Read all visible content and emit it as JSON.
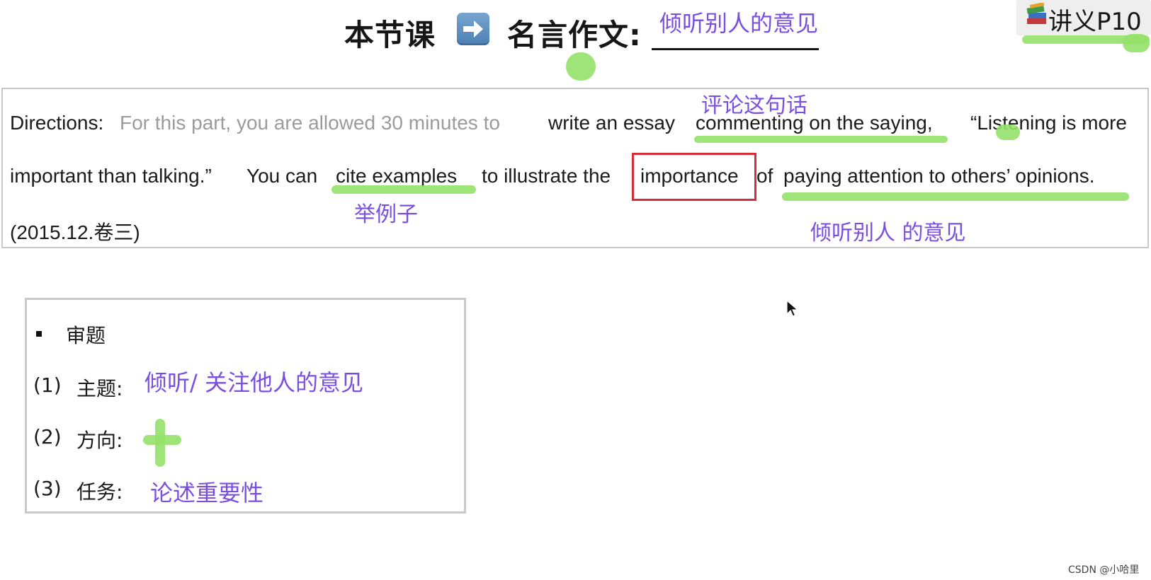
{
  "title": {
    "lesson": "本节课",
    "topic_label": "名言作文:",
    "topic_note": "倾听别人的意见",
    "arrow_icon": "right-arrow-icon"
  },
  "handout": {
    "label": "讲义P10",
    "icon": "books-icon"
  },
  "directions": {
    "label": "Directions:",
    "intro_gray": "For this part, you are allowed 30 minutes to",
    "l1_task": "write an essay",
    "l1_commenting": "commenting on the saying,",
    "l1_quote": "“Listening is more",
    "l2_a": "important than talking.”",
    "l2_you_can": "You can",
    "l2_cite": "cite examples",
    "l2_to_illustrate": "to illustrate the",
    "l2_importance": "importance",
    "l2_of": "of",
    "l2_paying": "paying attention to others’ opinions.",
    "l3_source": "(2015.12.卷三)",
    "note_commenting": "评论这句话",
    "note_cite": "举例子",
    "note_paying": "倾听别人 的意见"
  },
  "analysis": {
    "heading": "审题",
    "items": [
      {
        "num": "(1)",
        "label": "主题:",
        "note": "倾听/  关注他人的意见"
      },
      {
        "num": "(2)",
        "label": "方向:",
        "note": ""
      },
      {
        "num": "(3)",
        "label": "任务:",
        "note": "论述重要性"
      }
    ]
  },
  "watermark": "CSDN @小哈里",
  "colors": {
    "note": "#7a4fe0",
    "highlight": "#94e169",
    "box_red": "#d72c3a"
  }
}
